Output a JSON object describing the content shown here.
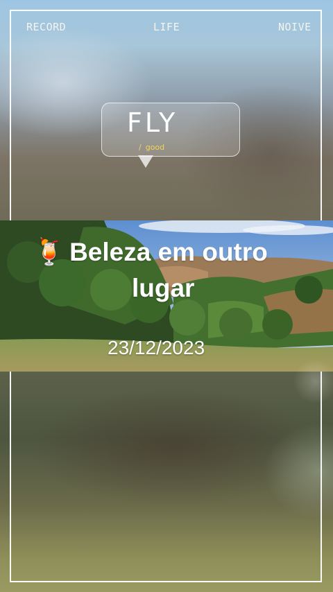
{
  "top_bar": {
    "left_label": "RECORD",
    "center_label": "LIFE",
    "right_label": "NOIVE"
  },
  "bubble": {
    "title": "FLY",
    "divider": "/",
    "subtitle": "good"
  },
  "post": {
    "emoji": "🍹",
    "title_line1": "Beleza em outro",
    "title_line2": "lugar",
    "date": "23/12/2023"
  },
  "colors": {
    "frame": "#ffffff",
    "subtitle": "#f2d65a",
    "text": "#ffffff"
  }
}
